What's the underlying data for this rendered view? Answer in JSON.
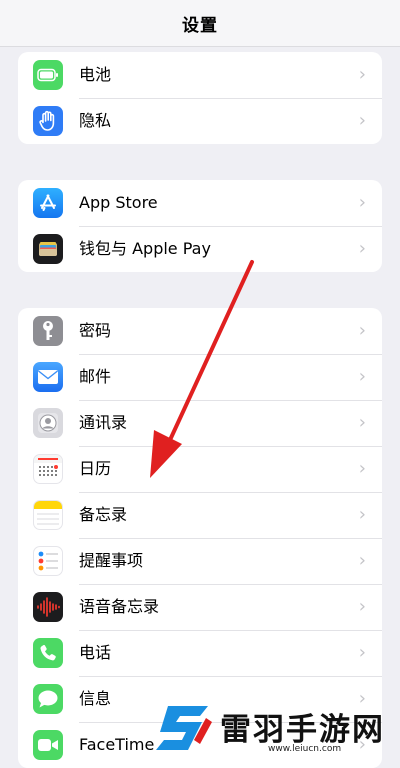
{
  "header": {
    "title": "设置"
  },
  "groups": [
    {
      "items": [
        {
          "label": "电池",
          "icon": "battery-icon",
          "color": "#4cd964"
        },
        {
          "label": "隐私",
          "icon": "hand-icon",
          "color": "#2f7cf6"
        }
      ]
    },
    {
      "items": [
        {
          "label": "App Store",
          "icon": "app-store-icon",
          "color": "#1d8cf8"
        },
        {
          "label": "钱包与 Apple Pay",
          "icon": "wallet-icon",
          "color": "#1c1c1e"
        }
      ]
    },
    {
      "items": [
        {
          "label": "密码",
          "icon": "key-icon",
          "color": "#8e8e93"
        },
        {
          "label": "邮件",
          "icon": "mail-icon",
          "color": "#2d8ef5"
        },
        {
          "label": "通讯录",
          "icon": "contacts-icon",
          "color": "#c7c7cc"
        },
        {
          "label": "日历",
          "icon": "calendar-icon",
          "color": "#ffffff"
        },
        {
          "label": "备忘录",
          "icon": "notes-icon",
          "color": "#ffd60a"
        },
        {
          "label": "提醒事项",
          "icon": "reminders-icon",
          "color": "#ffffff"
        },
        {
          "label": "语音备忘录",
          "icon": "voice-memos-icon",
          "color": "#1c1c1e"
        },
        {
          "label": "电话",
          "icon": "phone-icon",
          "color": "#4cd964"
        },
        {
          "label": "信息",
          "icon": "messages-icon",
          "color": "#4cd964"
        },
        {
          "label": "FaceTime",
          "icon": "facetime-icon",
          "color": "#4cd964"
        }
      ]
    }
  ],
  "chevron": "›",
  "annotation": {
    "color": "#e02020"
  },
  "watermark": {
    "text": "雷羽手游网",
    "url": "www.leiucn.com",
    "color": "#1a8fe0"
  }
}
